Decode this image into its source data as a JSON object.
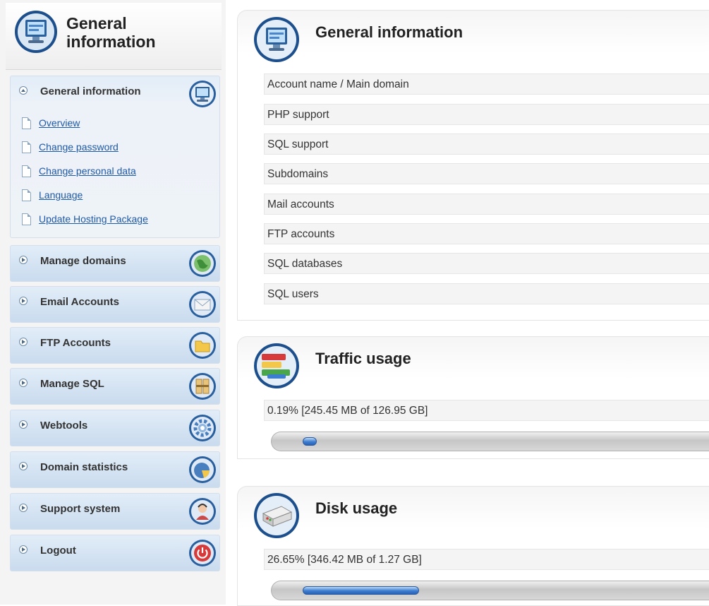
{
  "sidebar": {
    "title_line1": "General",
    "title_line2": "information",
    "open_section": {
      "label": "General information",
      "icon": "monitor-icon",
      "items": [
        {
          "label": "Overview"
        },
        {
          "label": "Change password"
        },
        {
          "label": "Change personal data"
        },
        {
          "label": "Language"
        },
        {
          "label": "Update Hosting Package"
        }
      ]
    },
    "sections": [
      {
        "label": "Manage domains",
        "icon": "globe-icon"
      },
      {
        "label": "Email Accounts",
        "icon": "envelope-icon"
      },
      {
        "label": "FTP Accounts",
        "icon": "folder-icon"
      },
      {
        "label": "Manage SQL",
        "icon": "database-icon"
      },
      {
        "label": "Webtools",
        "icon": "gear-icon"
      },
      {
        "label": "Domain statistics",
        "icon": "pie-chart-icon"
      },
      {
        "label": "Support system",
        "icon": "support-agent-icon"
      },
      {
        "label": "Logout",
        "icon": "power-icon"
      }
    ]
  },
  "general_info": {
    "title": "General information",
    "rows": [
      "Account name / Main domain",
      "PHP support",
      "SQL support",
      "Subdomains",
      "Mail accounts",
      "FTP accounts",
      "SQL databases",
      "SQL users"
    ]
  },
  "traffic": {
    "title": "Traffic usage",
    "text": "0.19% [245.45 MB of 126.95 GB]",
    "percent": 0.19
  },
  "disk": {
    "title": "Disk usage",
    "text": "26.65% [346.42 MB of 1.27 GB]",
    "percent": 26.65
  },
  "colors": {
    "accent": "#1f5aa8",
    "menu_bg": "#c9dbee",
    "progress_fill": "#3d7dd0"
  }
}
